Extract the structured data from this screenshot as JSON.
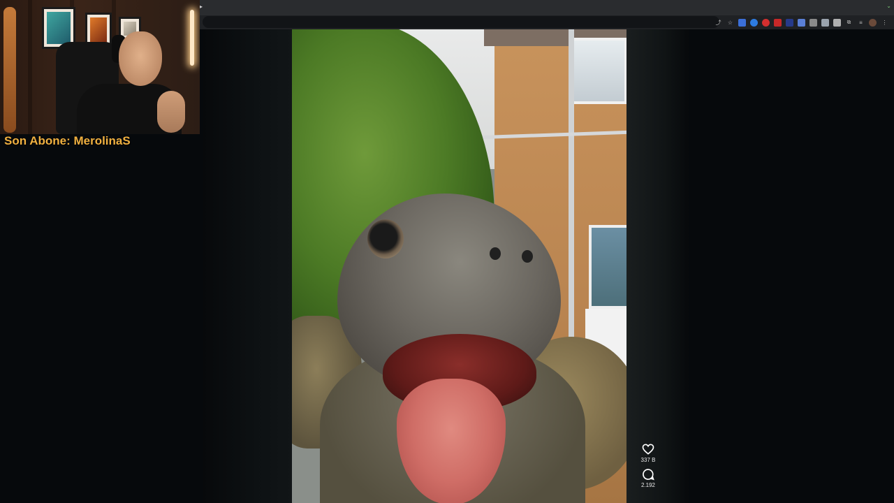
{
  "stream_overlay": {
    "caption": "Son Abone: MerolinaS"
  },
  "browser": {
    "toolbar_icons": [
      "share-icon",
      "star-icon",
      "extension-icon-1",
      "extension-icon-2",
      "extension-icon-3",
      "extension-icon-4",
      "extension-icon-5",
      "extension-icon-6",
      "extension-icon-7",
      "extension-icon-8",
      "extension-icon-9",
      "puzzle-icon",
      "tab-search-icon",
      "profile-avatar-icon",
      "menu-icon"
    ]
  },
  "video": {
    "subject": "tortoise"
  },
  "actions": {
    "like": {
      "icon": "heart-icon",
      "count": "337 B"
    },
    "comment": {
      "icon": "comment-icon",
      "count": "2.192"
    }
  },
  "colors": {
    "caption": "#f0b040",
    "page_background": "#06090c"
  }
}
